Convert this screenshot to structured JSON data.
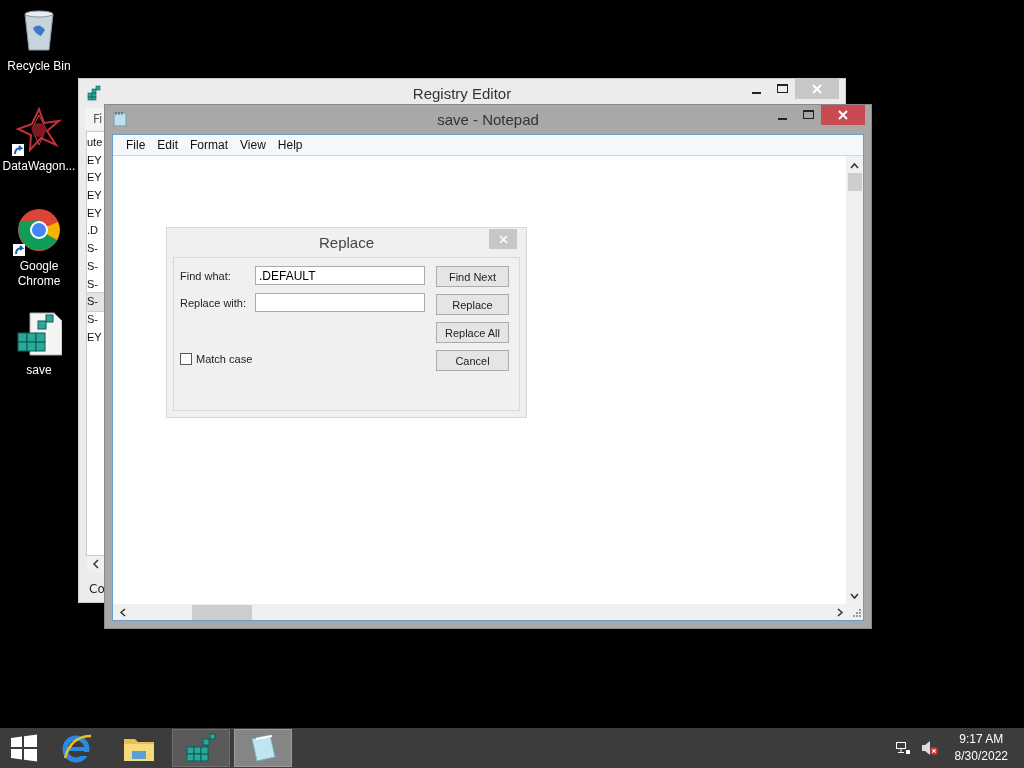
{
  "desktop_icons": [
    {
      "kind": "recycle",
      "label": "Recycle Bin",
      "shortcut": false
    },
    {
      "kind": "datawagon",
      "label": "DataWagon...",
      "shortcut": true
    },
    {
      "kind": "chrome",
      "label": "Google Chrome",
      "shortcut": true
    },
    {
      "kind": "registry",
      "label": "save",
      "shortcut": false
    }
  ],
  "registry_editor": {
    "title": "Registry Editor",
    "menu": "Fi",
    "tree_items": [
      {
        "label": "ute",
        "selected": false
      },
      {
        "label": "EY",
        "selected": false
      },
      {
        "label": "EY",
        "selected": false
      },
      {
        "label": "EY",
        "selected": false
      },
      {
        "label": "EY",
        "selected": false
      },
      {
        "label": ".D",
        "selected": false
      },
      {
        "label": "S-",
        "selected": false
      },
      {
        "label": "S-",
        "selected": false
      },
      {
        "label": "S-",
        "selected": false
      },
      {
        "label": "S-",
        "selected": true
      },
      {
        "label": "S-",
        "selected": false
      },
      {
        "label": "EY",
        "selected": false
      }
    ],
    "status": "Co"
  },
  "notepad": {
    "title": "save - Notepad",
    "menu": [
      "File",
      "Edit",
      "Format",
      "View",
      "Help"
    ]
  },
  "replace_dialog": {
    "title": "Replace",
    "fields": [
      {
        "label": "Find what:",
        "value": ".DEFAULT"
      },
      {
        "label": "Replace with:"
      }
    ],
    "match_case": {
      "label": "Match case",
      "checked": false
    },
    "buttons": [
      "Find Next",
      "Replace",
      "Replace All",
      "Cancel"
    ]
  },
  "taskbar": {
    "apps": [
      {
        "kind": "ie",
        "running": false,
        "selected": false
      },
      {
        "kind": "explorer",
        "running": false,
        "selected": false
      },
      {
        "kind": "registry",
        "running": true,
        "selected": false
      },
      {
        "kind": "notepad",
        "running": true,
        "selected": true
      }
    ],
    "time": "9:17 AM",
    "date": "8/30/2022"
  }
}
